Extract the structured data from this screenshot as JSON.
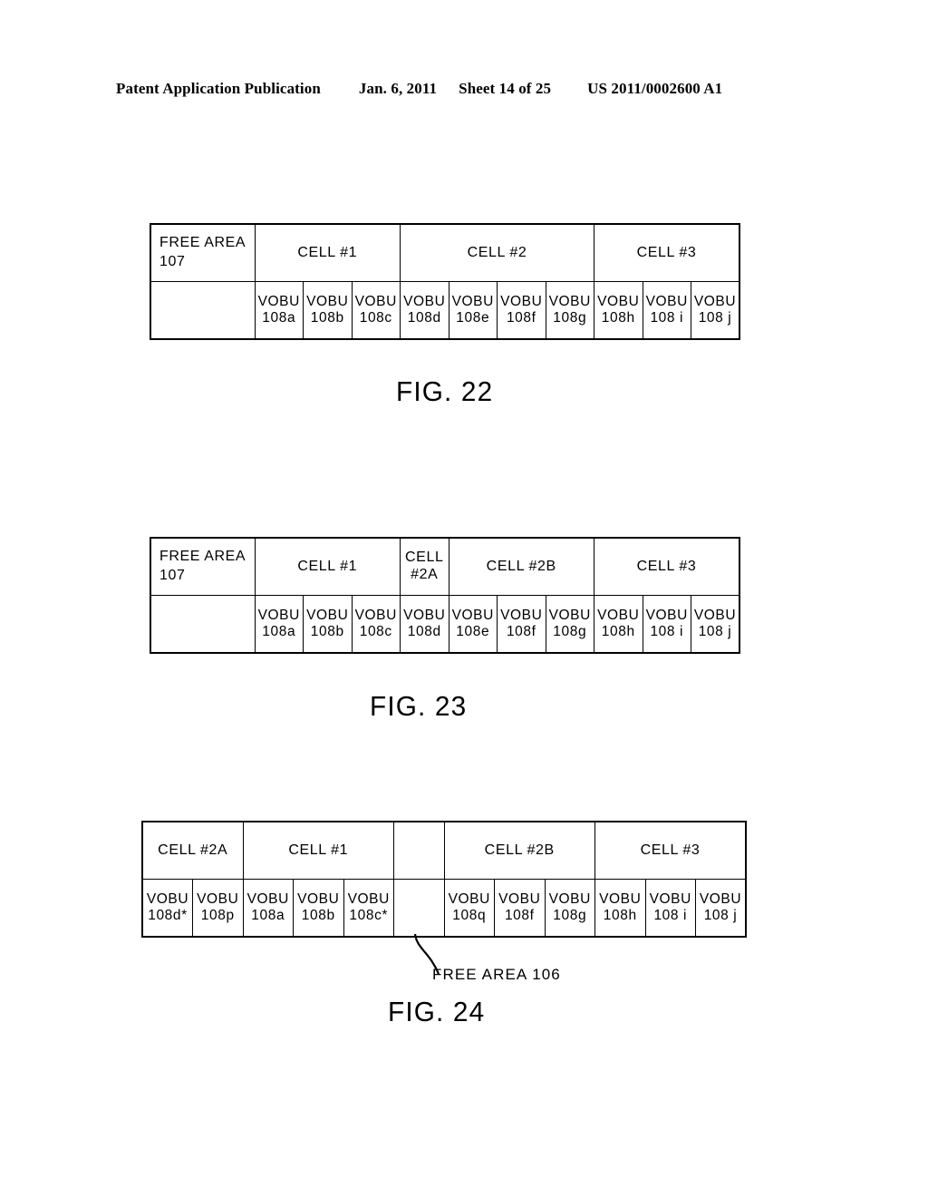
{
  "header": {
    "publication": "Patent Application Publication",
    "date": "Jan. 6, 2011",
    "sheet": "Sheet 14 of 25",
    "number": "US 2011/0002600 A1"
  },
  "figures": [
    {
      "id": "fig22",
      "caption": "FIG. 22",
      "free_area_label_line1": "FREE  AREA",
      "free_area_label_line2": "107",
      "header_row": [
        {
          "label": "CELL  #1",
          "span": 3
        },
        {
          "label": "CELL  #2",
          "span": 4
        },
        {
          "label": "CELL  #3",
          "span": 3
        }
      ],
      "data_row": [
        {
          "l1": "VOBU",
          "l2": "108a",
          "fill": "none"
        },
        {
          "l1": "VOBU",
          "l2": "108b",
          "fill": "none"
        },
        {
          "l1": "VOBU",
          "l2": "108c",
          "fill": "none"
        },
        {
          "l1": "VOBU",
          "l2": "108d",
          "fill": "none"
        },
        {
          "l1": "VOBU",
          "l2": "108e",
          "fill": "none"
        },
        {
          "l1": "VOBU",
          "l2": "108f",
          "fill": "none"
        },
        {
          "l1": "VOBU",
          "l2": "108g",
          "fill": "none"
        },
        {
          "l1": "VOBU",
          "l2": "108h",
          "fill": "none"
        },
        {
          "l1": "VOBU",
          "l2": "108 i",
          "fill": "none"
        },
        {
          "l1": "VOBU",
          "l2": "108 j",
          "fill": "none"
        }
      ]
    },
    {
      "id": "fig23",
      "caption": "FIG. 23",
      "free_area_label_line1": "FREE  AREA",
      "free_area_label_line2": "107",
      "header_row": [
        {
          "label": "CELL  #1",
          "span": 3
        },
        {
          "label": "CELL\n#2A",
          "span": 1
        },
        {
          "label": "CELL  #2B",
          "span": 3
        },
        {
          "label": "CELL  #3",
          "span": 3
        }
      ],
      "data_row": [
        {
          "l1": "VOBU",
          "l2": "108a",
          "fill": "none"
        },
        {
          "l1": "VOBU",
          "l2": "108b",
          "fill": "none"
        },
        {
          "l1": "VOBU",
          "l2": "108c",
          "fill": "dots"
        },
        {
          "l1": "VOBU",
          "l2": "108d",
          "fill": "dots"
        },
        {
          "l1": "VOBU",
          "l2": "108e",
          "fill": "hatch"
        },
        {
          "l1": "VOBU",
          "l2": "108f",
          "fill": "none"
        },
        {
          "l1": "VOBU",
          "l2": "108g",
          "fill": "none"
        },
        {
          "l1": "VOBU",
          "l2": "108h",
          "fill": "none"
        },
        {
          "l1": "VOBU",
          "l2": "108 i",
          "fill": "none"
        },
        {
          "l1": "VOBU",
          "l2": "108 j",
          "fill": "none"
        }
      ]
    },
    {
      "id": "fig24",
      "caption": "FIG. 24",
      "callout": "FREE  AREA  106",
      "header_row": [
        {
          "label": "CELL  #2A",
          "span": 2
        },
        {
          "label": "CELL  #1",
          "span": 3
        },
        {
          "label": "",
          "span": 1
        },
        {
          "label": "CELL  #2B",
          "span": 3
        },
        {
          "label": "CELL  #3",
          "span": 3
        }
      ],
      "data_row": [
        {
          "l1": "VOBU",
          "l2": "108d*",
          "fill": "dots"
        },
        {
          "l1": "VOBU",
          "l2": "108p",
          "fill": "hatch"
        },
        {
          "l1": "VOBU",
          "l2": "108a",
          "fill": "none"
        },
        {
          "l1": "VOBU",
          "l2": "108b",
          "fill": "none"
        },
        {
          "l1": "VOBU",
          "l2": "108c*",
          "fill": "dots"
        },
        {
          "l1": "",
          "l2": "",
          "fill": "none"
        },
        {
          "l1": "VOBU",
          "l2": "108q",
          "fill": "hatch"
        },
        {
          "l1": "VOBU",
          "l2": "108f",
          "fill": "none"
        },
        {
          "l1": "VOBU",
          "l2": "108g",
          "fill": "none"
        },
        {
          "l1": "VOBU",
          "l2": "108h",
          "fill": "none"
        },
        {
          "l1": "VOBU",
          "l2": "108 i",
          "fill": "none"
        },
        {
          "l1": "VOBU",
          "l2": "108 j",
          "fill": "none"
        }
      ]
    }
  ]
}
